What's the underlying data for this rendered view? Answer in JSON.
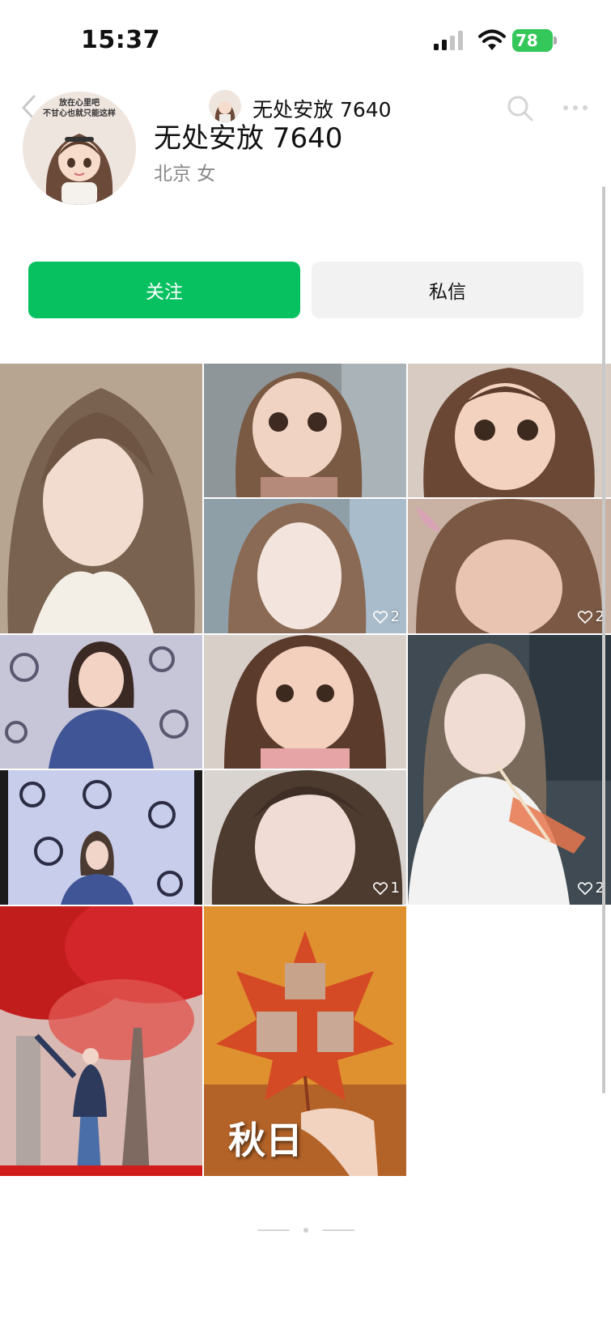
{
  "status_bar": {
    "time": "15:37",
    "battery": "78"
  },
  "nav": {
    "title": "无处安放 7640"
  },
  "profile": {
    "name": "无处安放 7640",
    "meta": "北京 女",
    "avatar_caption_1": "放在心里吧",
    "avatar_caption_2": "不甘心也就只能这样"
  },
  "actions": {
    "follow_label": "关注",
    "message_label": "私信"
  },
  "grid": {
    "tiles": [
      {
        "likes": ""
      },
      {
        "likes": ""
      },
      {
        "likes": ""
      },
      {
        "likes": "2"
      },
      {
        "likes": "2"
      },
      {
        "likes": ""
      },
      {
        "likes": ""
      },
      {
        "likes": ""
      },
      {
        "likes": "2"
      },
      {
        "likes": ""
      },
      {
        "likes": "1"
      },
      {
        "likes": ""
      },
      {
        "likes": "",
        "caption": "秋日"
      }
    ]
  },
  "colors": {
    "accent": "#07c160",
    "secondary_button": "#f2f2f2",
    "battery": "#34c759"
  },
  "icons": [
    "back-icon",
    "search-icon",
    "more-icon",
    "signal-icon",
    "wifi-icon",
    "heart-icon"
  ]
}
